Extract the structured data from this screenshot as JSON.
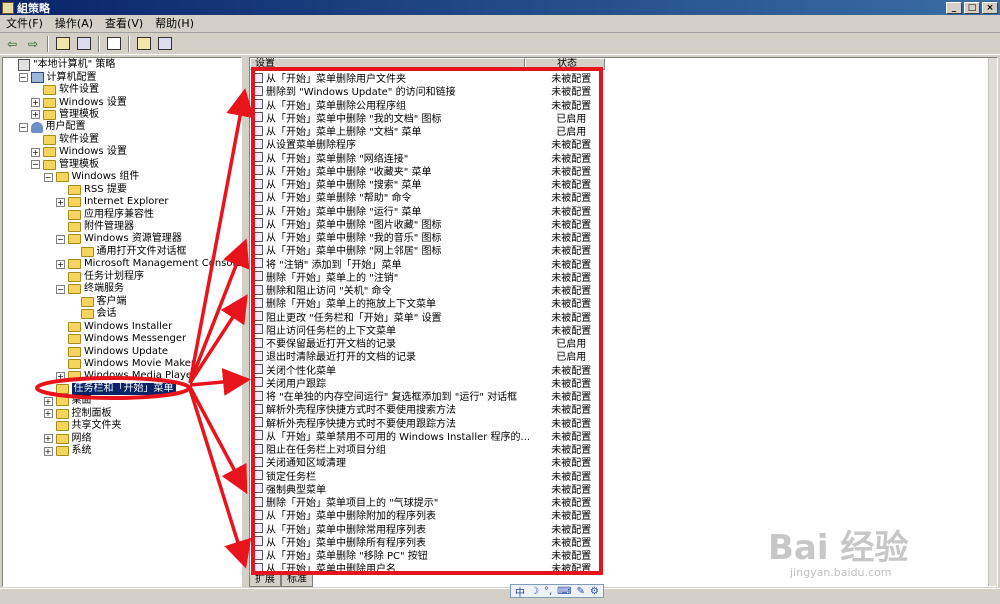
{
  "window": {
    "title": "組策略",
    "btn_min": "_",
    "btn_max": "□",
    "btn_close": "×"
  },
  "menubar": {
    "items": [
      "文件(F)",
      "操作(A)",
      "查看(V)",
      "帮助(H)"
    ]
  },
  "toolbar": {
    "back": "⇦",
    "forward": "⇨"
  },
  "tree": [
    {
      "label": "\"本地计算机\" 策略",
      "level": 0,
      "exp": "",
      "icon": "policy"
    },
    {
      "label": "计算机配置",
      "level": 1,
      "exp": "−",
      "icon": "pc"
    },
    {
      "label": "软件设置",
      "level": 2,
      "exp": "",
      "icon": "folder"
    },
    {
      "label": "Windows 设置",
      "level": 2,
      "exp": "+",
      "icon": "folder"
    },
    {
      "label": "管理模板",
      "level": 2,
      "exp": "+",
      "icon": "folder"
    },
    {
      "label": "用户配置",
      "level": 1,
      "exp": "−",
      "icon": "user"
    },
    {
      "label": "软件设置",
      "level": 2,
      "exp": "",
      "icon": "folder"
    },
    {
      "label": "Windows 设置",
      "level": 2,
      "exp": "+",
      "icon": "folder"
    },
    {
      "label": "管理模板",
      "level": 2,
      "exp": "−",
      "icon": "folder"
    },
    {
      "label": "Windows 组件",
      "level": 3,
      "exp": "−",
      "icon": "folder"
    },
    {
      "label": "RSS 提要",
      "level": 4,
      "exp": "",
      "icon": "folder"
    },
    {
      "label": "Internet Explorer",
      "level": 4,
      "exp": "+",
      "icon": "folder"
    },
    {
      "label": "应用程序兼容性",
      "level": 4,
      "exp": "",
      "icon": "folder"
    },
    {
      "label": "附件管理器",
      "level": 4,
      "exp": "",
      "icon": "folder"
    },
    {
      "label": "Windows 资源管理器",
      "level": 4,
      "exp": "−",
      "icon": "folder"
    },
    {
      "label": "通用打开文件对话框",
      "level": 5,
      "exp": "",
      "icon": "folder"
    },
    {
      "label": "Microsoft Management Console",
      "level": 4,
      "exp": "+",
      "icon": "folder"
    },
    {
      "label": "任务计划程序",
      "level": 4,
      "exp": "",
      "icon": "folder"
    },
    {
      "label": "终端服务",
      "level": 4,
      "exp": "−",
      "icon": "folder"
    },
    {
      "label": "客户端",
      "level": 5,
      "exp": "",
      "icon": "folder"
    },
    {
      "label": "会话",
      "level": 5,
      "exp": "",
      "icon": "folder"
    },
    {
      "label": "Windows Installer",
      "level": 4,
      "exp": "",
      "icon": "folder"
    },
    {
      "label": "Windows Messenger",
      "level": 4,
      "exp": "",
      "icon": "folder"
    },
    {
      "label": "Windows Update",
      "level": 4,
      "exp": "",
      "icon": "folder"
    },
    {
      "label": "Windows Movie Maker",
      "level": 4,
      "exp": "",
      "icon": "folder"
    },
    {
      "label": "Windows Media Player",
      "level": 4,
      "exp": "+",
      "icon": "folder"
    },
    {
      "label": "任务栏和「开始」菜单",
      "level": 3,
      "exp": "",
      "icon": "folder",
      "selected": true
    },
    {
      "label": "桌面",
      "level": 3,
      "exp": "+",
      "icon": "folder"
    },
    {
      "label": "控制面板",
      "level": 3,
      "exp": "+",
      "icon": "folder"
    },
    {
      "label": "共享文件夹",
      "level": 3,
      "exp": "",
      "icon": "folder"
    },
    {
      "label": "网络",
      "level": 3,
      "exp": "+",
      "icon": "folder"
    },
    {
      "label": "系统",
      "level": 3,
      "exp": "+",
      "icon": "folder"
    }
  ],
  "list": {
    "col_setting": "设置",
    "col_state": "状态",
    "rows": [
      {
        "name": "从「开始」菜单删除用户文件夹",
        "state": "未被配置"
      },
      {
        "name": "删除到 \"Windows Update\" 的访问和链接",
        "state": "未被配置"
      },
      {
        "name": "从「开始」菜单删除公用程序组",
        "state": "未被配置"
      },
      {
        "name": "从「开始」菜单中删除 \"我的文档\" 图标",
        "state": "已启用"
      },
      {
        "name": "从「开始」菜单上删除 \"文档\" 菜单",
        "state": "已启用"
      },
      {
        "name": "从设置菜单删除程序",
        "state": "未被配置"
      },
      {
        "name": "从「开始」菜单删除 \"网络连接\"",
        "state": "未被配置"
      },
      {
        "name": "从「开始」菜单中删除 \"收藏夹\" 菜单",
        "state": "未被配置"
      },
      {
        "name": "从「开始」菜单中删除 \"搜索\" 菜单",
        "state": "未被配置"
      },
      {
        "name": "从「开始」菜单删除 \"帮助\" 命令",
        "state": "未被配置"
      },
      {
        "name": "从「开始」菜单中删除 \"运行\" 菜单",
        "state": "未被配置"
      },
      {
        "name": "从「开始」菜单中删除 \"图片收藏\" 图标",
        "state": "未被配置"
      },
      {
        "name": "从「开始」菜单中删除 \"我的音乐\" 图标",
        "state": "未被配置"
      },
      {
        "name": "从「开始」菜单中删除 \"网上邻居\" 图标",
        "state": "未被配置"
      },
      {
        "name": "将 \"注销\" 添加到「开始」菜单",
        "state": "未被配置"
      },
      {
        "name": "删除「开始」菜单上的 \"注销\"",
        "state": "未被配置"
      },
      {
        "name": "删除和阻止访问 \"关机\" 命令",
        "state": "未被配置"
      },
      {
        "name": "删除「开始」菜单上的拖放上下文菜单",
        "state": "未被配置"
      },
      {
        "name": "阻止更改 \"任务栏和「开始」菜单\" 设置",
        "state": "未被配置"
      },
      {
        "name": "阻止访问任务栏的上下文菜单",
        "state": "未被配置"
      },
      {
        "name": "不要保留最近打开文档的记录",
        "state": "已启用"
      },
      {
        "name": "退出时清除最近打开的文档的记录",
        "state": "已启用"
      },
      {
        "name": "关闭个性化菜单",
        "state": "未被配置"
      },
      {
        "name": "关闭用户跟踪",
        "state": "未被配置"
      },
      {
        "name": "将 \"在单独的内存空间运行\" 复选框添加到 \"运行\" 对话框",
        "state": "未被配置"
      },
      {
        "name": "解析外壳程序快捷方式时不要使用搜索方法",
        "state": "未被配置"
      },
      {
        "name": "解析外壳程序快捷方式时不要使用跟踪方法",
        "state": "未被配置"
      },
      {
        "name": "从「开始」菜单禁用不可用的 Windows Installer 程序的...",
        "state": "未被配置"
      },
      {
        "name": "阻止在任务栏上对项目分组",
        "state": "未被配置"
      },
      {
        "name": "关闭通知区域清理",
        "state": "未被配置"
      },
      {
        "name": "锁定任务栏",
        "state": "未被配置"
      },
      {
        "name": "强制典型菜单",
        "state": "未被配置"
      },
      {
        "name": "删除「开始」菜单项目上的 \"气球提示\"",
        "state": "未被配置"
      },
      {
        "name": "从「开始」菜单中删除附加的程序列表",
        "state": "未被配置"
      },
      {
        "name": "从「开始」菜单中删除常用程序列表",
        "state": "未被配置"
      },
      {
        "name": "从「开始」菜单中删除所有程序列表",
        "state": "未被配置"
      },
      {
        "name": "从「开始」菜单删除 \"移除 PC\" 按钮",
        "state": "未被配置"
      },
      {
        "name": "从「开始」菜单中删除用户名",
        "state": "未被配置"
      }
    ]
  },
  "tabs": [
    "扩展",
    "标准"
  ],
  "ime": [
    "中",
    "☽",
    "°,",
    "⌨",
    "✎",
    "⚙"
  ],
  "watermark": {
    "brand": "Bai 经验",
    "url": "jingyan.baidu.com"
  },
  "colors": {
    "highlight": "#e8141c",
    "selection": "#0a246a"
  }
}
